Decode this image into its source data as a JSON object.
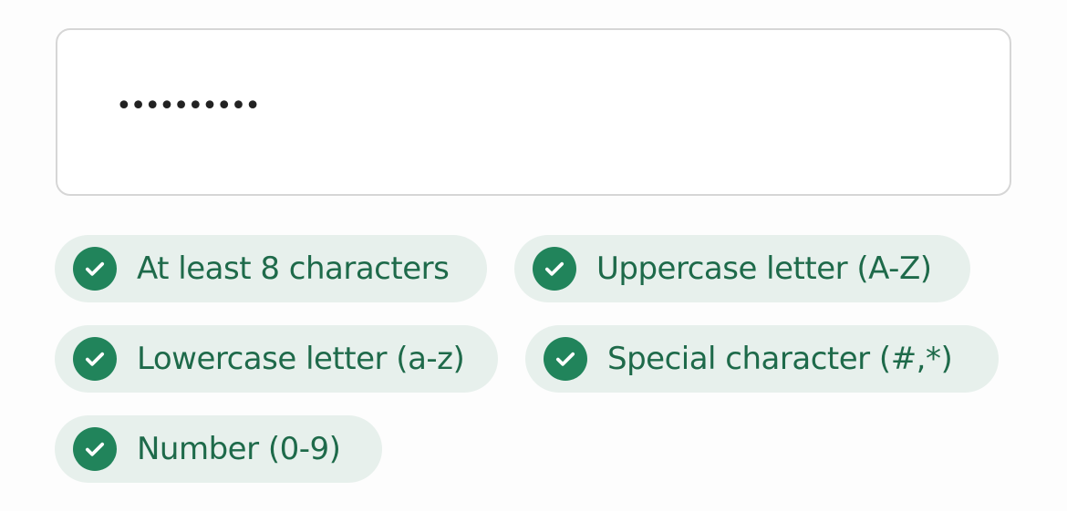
{
  "password": {
    "value": "..........",
    "masked_display": "··········"
  },
  "requirements": [
    {
      "label": "At least 8 characters",
      "met": true,
      "icon": "check-circle-icon"
    },
    {
      "label": "Uppercase letter (A-Z)",
      "met": true,
      "icon": "check-circle-icon"
    },
    {
      "label": "Lowercase letter (a-z)",
      "met": true,
      "icon": "check-circle-icon"
    },
    {
      "label": "Special character (#,*)",
      "met": true,
      "icon": "check-circle-icon"
    },
    {
      "label": "Number (0-9)",
      "met": true,
      "icon": "check-circle-icon"
    }
  ],
  "colors": {
    "chip_background": "#e7f0ec",
    "check_fill": "#21845b",
    "label_text": "#1e6a4a",
    "field_border": "#d6d6d6"
  }
}
